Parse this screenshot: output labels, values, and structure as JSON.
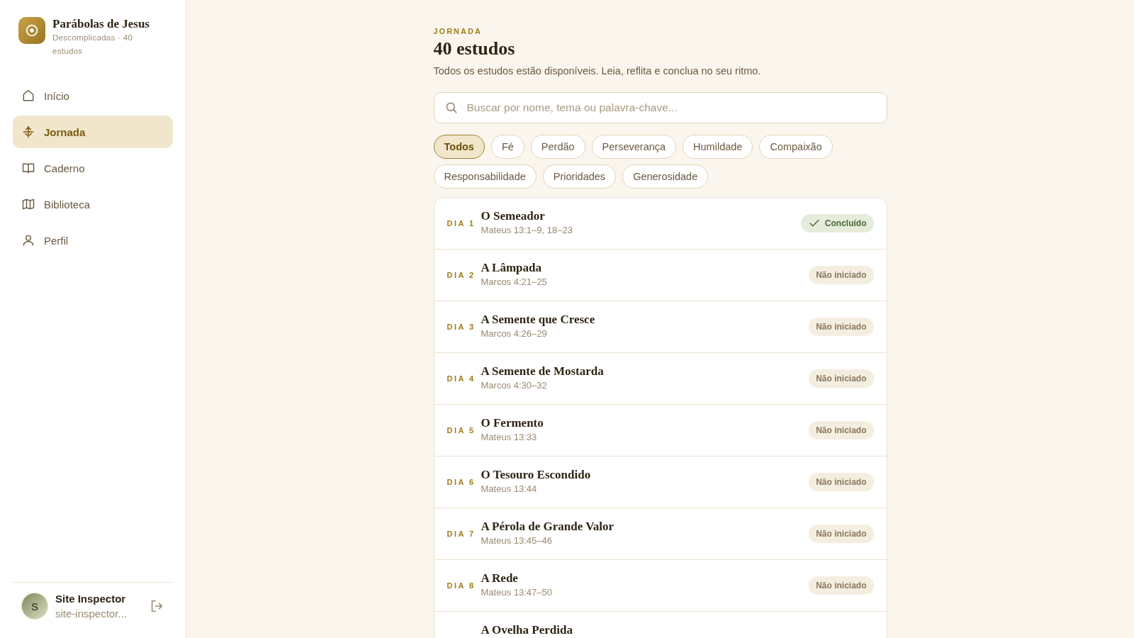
{
  "app": {
    "title": "Parábolas de Jesus",
    "subtitle": "Descomplicadas · 40 estudos"
  },
  "nav": [
    {
      "label": "Início",
      "selected": false
    },
    {
      "label": "Jornada",
      "selected": true
    },
    {
      "label": "Caderno",
      "selected": false
    },
    {
      "label": "Biblioteca",
      "selected": false
    },
    {
      "label": "Perfil",
      "selected": false
    }
  ],
  "user": {
    "initial": "S",
    "name": "Site Inspector",
    "email": "site-inspector..."
  },
  "header": {
    "eyebrow": "JORNADA",
    "title": "40 estudos",
    "description": "Todos os estudos estão disponíveis. Leia, reflita e conclua no seu ritmo."
  },
  "search": {
    "placeholder": "Buscar por nome, tema ou palavra-chave..."
  },
  "filters": [
    {
      "label": "Todos",
      "selected": true
    },
    {
      "label": "Fé",
      "selected": false
    },
    {
      "label": "Perdão",
      "selected": false
    },
    {
      "label": "Perseverança",
      "selected": false
    },
    {
      "label": "Humildade",
      "selected": false
    },
    {
      "label": "Compaixão",
      "selected": false
    },
    {
      "label": "Responsabilidade",
      "selected": false
    },
    {
      "label": "Prioridades",
      "selected": false
    },
    {
      "label": "Generosidade",
      "selected": false
    }
  ],
  "studies": [
    {
      "day": "DIA 1",
      "title": "O Semeador",
      "reference": "Mateus 13:1–9, 18–23",
      "status": {
        "kind": "done",
        "label": "Concluído"
      }
    },
    {
      "day": "DIA 2",
      "title": "A Lâmpada",
      "reference": "Marcos 4:21–25",
      "status": {
        "kind": "not_started",
        "label": "Não iniciado"
      }
    },
    {
      "day": "DIA 3",
      "title": "A Semente que Cresce",
      "reference": "Marcos 4:26–29",
      "status": {
        "kind": "not_started",
        "label": "Não iniciado"
      }
    },
    {
      "day": "DIA 4",
      "title": "A Semente de Mostarda",
      "reference": "Marcos 4:30–32",
      "status": {
        "kind": "not_started",
        "label": "Não iniciado"
      }
    },
    {
      "day": "DIA 5",
      "title": "O Fermento",
      "reference": "Mateus 13:33",
      "status": {
        "kind": "not_started",
        "label": "Não iniciado"
      }
    },
    {
      "day": "DIA 6",
      "title": "O Tesouro Escondido",
      "reference": "Mateus 13:44",
      "status": {
        "kind": "not_started",
        "label": "Não iniciado"
      }
    },
    {
      "day": "DIA 7",
      "title": "A Pérola de Grande Valor",
      "reference": "Mateus 13:45–46",
      "status": {
        "kind": "not_started",
        "label": "Não iniciado"
      }
    },
    {
      "day": "DIA 8",
      "title": "A Rede",
      "reference": "Mateus 13:47–50",
      "status": {
        "kind": "not_started",
        "label": "Não iniciado"
      }
    },
    {
      "title": "A Ovelha Perdida"
    }
  ]
}
